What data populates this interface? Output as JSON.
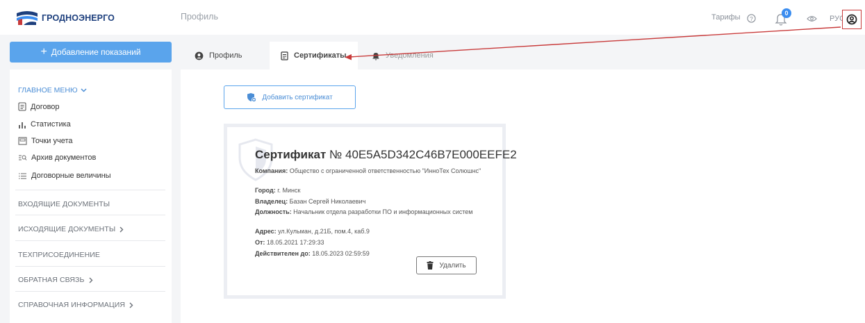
{
  "header": {
    "logo_text": "ГРОДНОЭНЕРГО",
    "breadcrumb": "Профиль",
    "tariffs_label": "Тарифы",
    "notification_count": "0",
    "language": "РУС"
  },
  "sidebar": {
    "add_reading_label": "Добавление показаний",
    "main_menu_label": "ГЛАВНОЕ МЕНЮ",
    "items": [
      {
        "label": "Договор",
        "icon": "contract-icon"
      },
      {
        "label": "Статистика",
        "icon": "bar-chart-icon"
      },
      {
        "label": "Точки учета",
        "icon": "meter-icon"
      },
      {
        "label": "Архив документов",
        "icon": "archive-search-icon"
      },
      {
        "label": "Договорные величины",
        "icon": "list-icon"
      }
    ],
    "sections": [
      {
        "label": "ВХОДЯЩИЕ ДОКУМЕНТЫ"
      },
      {
        "label": "ИСХОДЯЩИЕ ДОКУМЕНТЫ"
      },
      {
        "label": "ТЕХПРИСОЕДИНЕНИЕ"
      },
      {
        "label": "ОБРАТНАЯ СВЯЗЬ"
      },
      {
        "label": "СПРАВОЧНАЯ ИНФОРМАЦИЯ"
      }
    ]
  },
  "tabs": [
    {
      "label": "Профиль"
    },
    {
      "label": "Сертификаты"
    },
    {
      "label": "Уведомления"
    }
  ],
  "add_certificate_label": "Добавить сертификат",
  "certificate": {
    "title_word": "Сертификат",
    "number": "№ 40E5A5D342C46B7E000EEFE2",
    "company_key": "Компания:",
    "company": "Общество с ограниченной ответственностью \"ИнноТех Солюшнс\"",
    "city_key": "Город:",
    "city": "г. Минск",
    "owner_key": "Владелец:",
    "owner": "Базан Сергей Николаевич",
    "position_key": "Должность:",
    "position": "Начальник отдела разработки ПО и информационных систем",
    "address_key": "Адрес:",
    "address": "ул.Кульман, д.21Б, пом.4, каб.9",
    "from_key": "От:",
    "from": "18.05.2021 17:29:33",
    "valid_key": "Действителен до:",
    "valid_until": "18.05.2023 02:59:59",
    "delete_label": "Удалить"
  },
  "colors": {
    "accent": "#5aa4ec",
    "brand": "#1d3f7d",
    "annotation": "#c83a3a"
  }
}
